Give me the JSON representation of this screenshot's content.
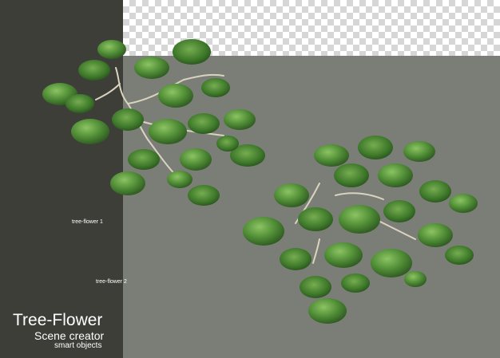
{
  "labels": {
    "item1": "tree-flower 1",
    "item2": "tree-flower 2"
  },
  "branding": {
    "title": "Tree-Flower",
    "subtitle": "Scene creator",
    "tagline": "smart objects"
  },
  "colors": {
    "left_panel": "#3d3e38",
    "background": "#7b7e76",
    "leaf_dark": "#2f5a22",
    "leaf_mid": "#4d8a34",
    "leaf_light": "#7fb85a",
    "branch": "#d9d3c0"
  }
}
